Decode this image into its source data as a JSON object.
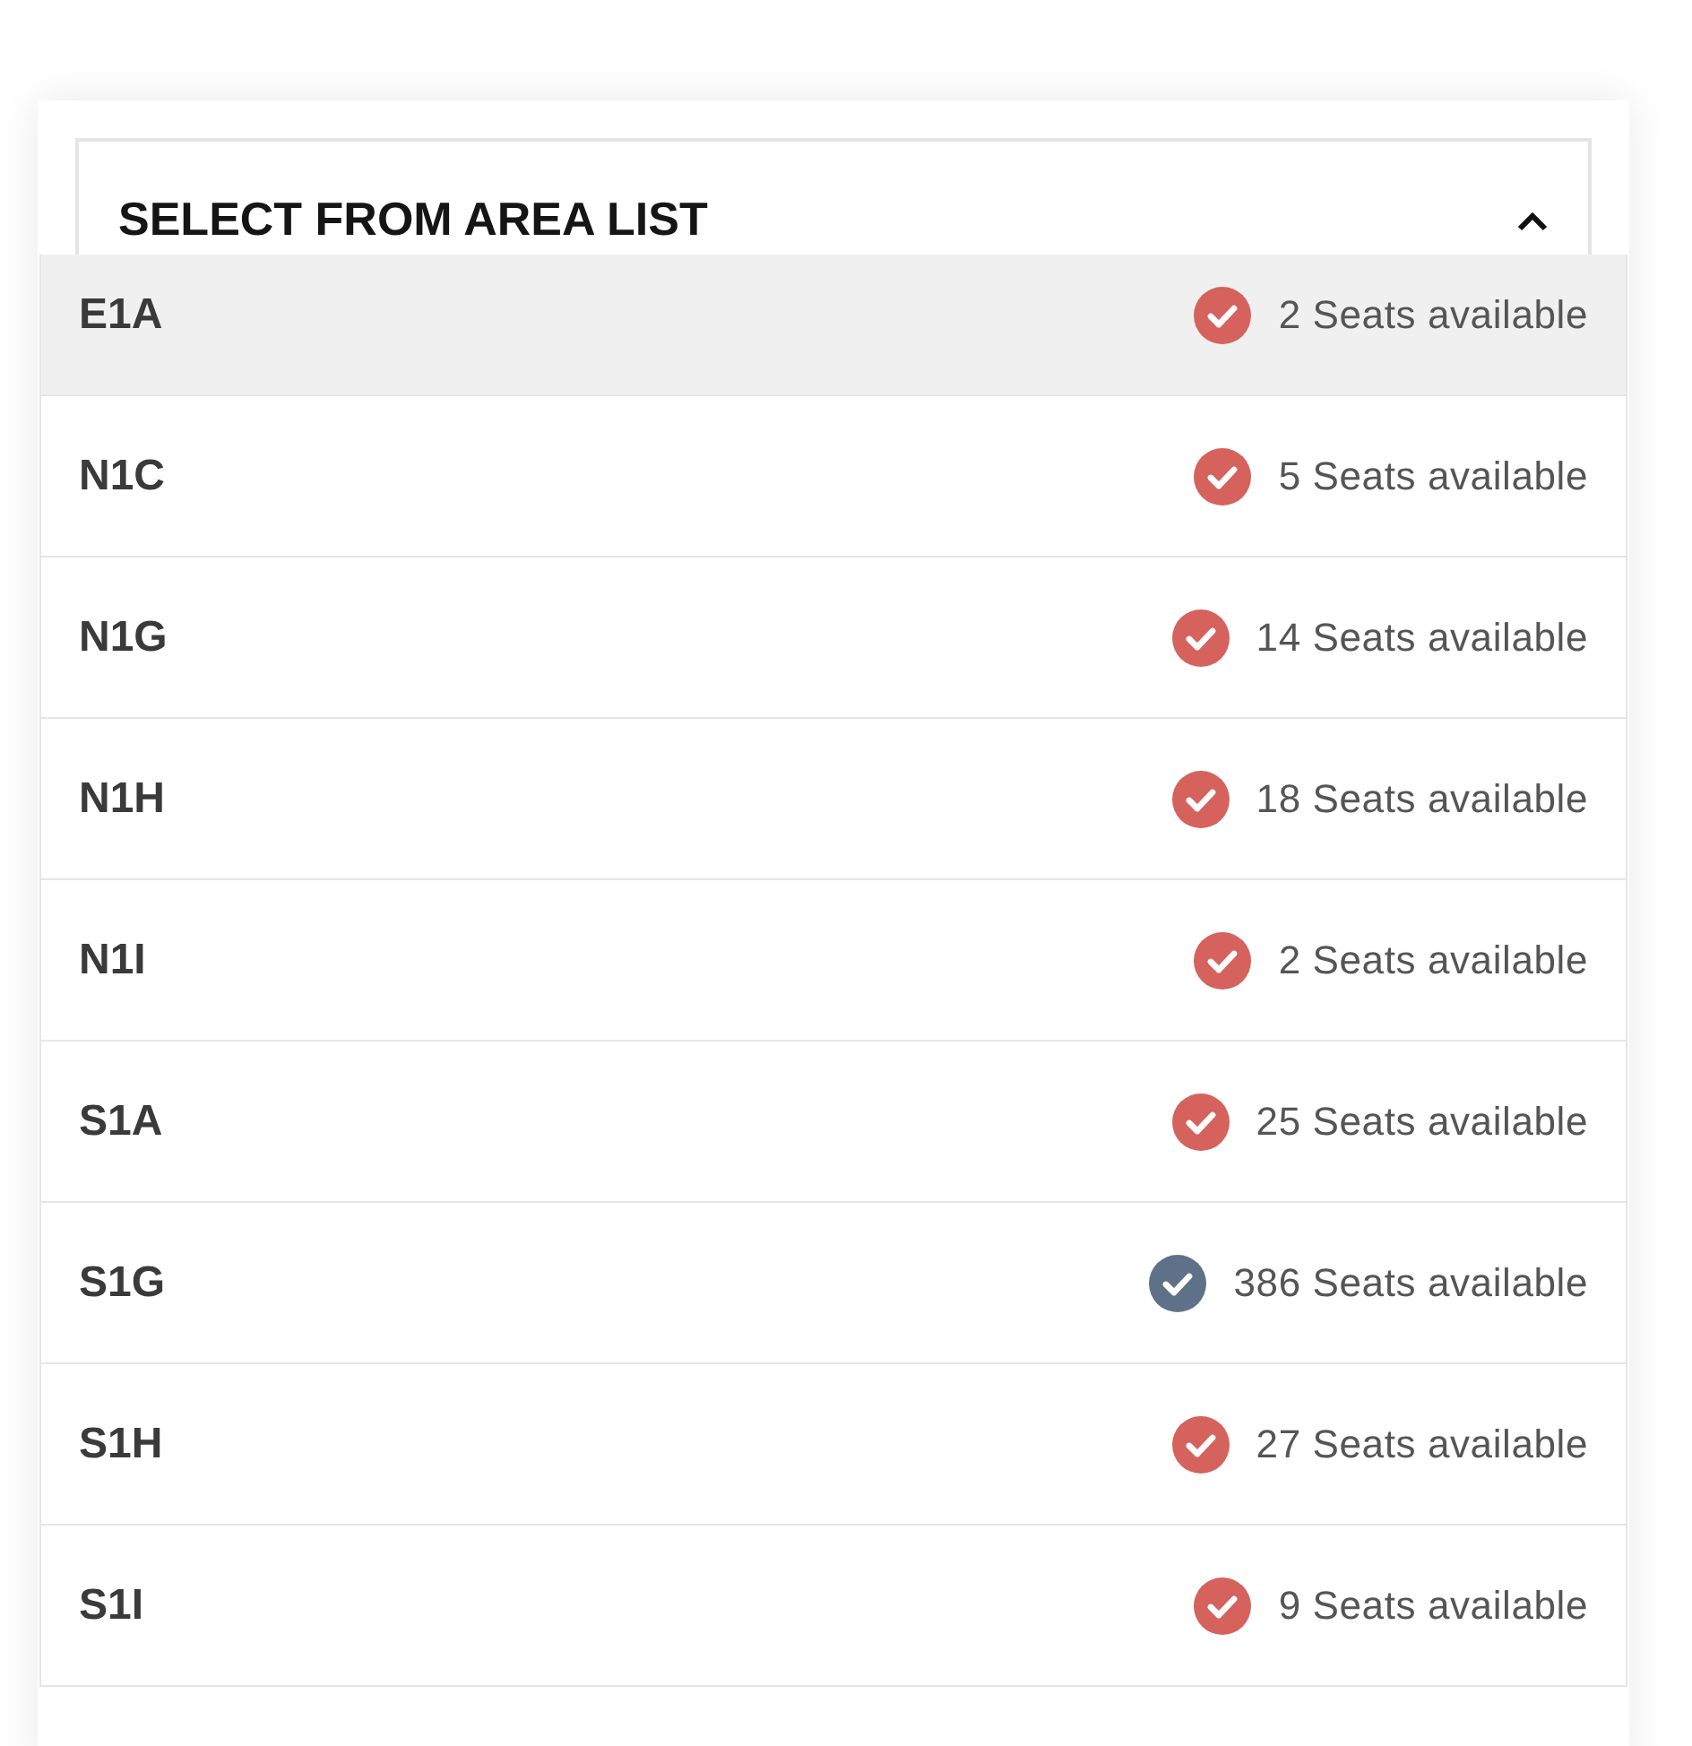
{
  "dropdown": {
    "label": "SELECT FROM AREA LIST",
    "expanded": true
  },
  "areas": [
    {
      "name": "E1A",
      "seats": "2 Seats available",
      "color": "#d6625d",
      "selected": true
    },
    {
      "name": "N1C",
      "seats": "5 Seats available",
      "color": "#d6625d",
      "selected": false
    },
    {
      "name": "N1G",
      "seats": "14 Seats available",
      "color": "#d6625d",
      "selected": false
    },
    {
      "name": "N1H",
      "seats": "18 Seats available",
      "color": "#d6625d",
      "selected": false
    },
    {
      "name": "N1I",
      "seats": "2 Seats available",
      "color": "#d6625d",
      "selected": false
    },
    {
      "name": "S1A",
      "seats": "25 Seats available",
      "color": "#d6625d",
      "selected": false
    },
    {
      "name": "S1G",
      "seats": "386 Seats available",
      "color": "#5f7188",
      "selected": false
    },
    {
      "name": "S1H",
      "seats": "27 Seats available",
      "color": "#d6625d",
      "selected": false
    },
    {
      "name": "S1I",
      "seats": "9 Seats available",
      "color": "#d6625d",
      "selected": false
    }
  ]
}
